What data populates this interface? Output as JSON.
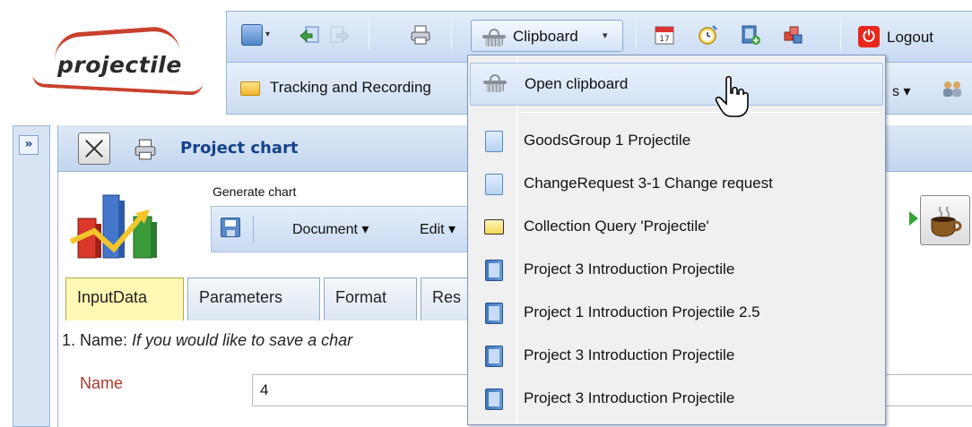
{
  "logo": {
    "text": "projectile"
  },
  "toolbar": {
    "clipboard_label": "Clipboard",
    "clipboard_caret": "▾",
    "logout_label": "Logout",
    "calendar_icon_text": "17"
  },
  "toolbar2": {
    "tracking_label": "Tracking and Recording",
    "s_label": "s ▾"
  },
  "left_strip": {
    "expand_glyph": "»"
  },
  "panel": {
    "title": "Project chart",
    "generate_label": "Generate chart",
    "document_menu": "Document ▾",
    "edit_menu": "Edit ▾"
  },
  "tabs": [
    {
      "label": "InputData"
    },
    {
      "label": "Parameters"
    },
    {
      "label": "Format"
    },
    {
      "label": "Res"
    }
  ],
  "form": {
    "name_prefix": "1. Name: ",
    "name_hint": "If you would like to save a char",
    "name_label": "Name",
    "name_value": "4"
  },
  "clipboard_menu": {
    "open_label": "Open clipboard",
    "items": [
      {
        "label": "GoodsGroup 1 Projectile",
        "icon": "document-light-icon"
      },
      {
        "label": "ChangeRequest 3-1 Change request",
        "icon": "document-light-icon"
      },
      {
        "label": "Collection Query 'Projectile'",
        "icon": "folder-icon"
      },
      {
        "label": "Project 3 Introduction Projectile",
        "icon": "document-dark-icon"
      },
      {
        "label": "Project 1 Introduction Projectile 2.5",
        "icon": "document-dark-icon"
      },
      {
        "label": "Project 3 Introduction Projectile",
        "icon": "document-dark-icon"
      },
      {
        "label": "Project 3 Introduction Projectile",
        "icon": "document-dark-icon"
      }
    ]
  },
  "colors": {
    "accent": "#15428b",
    "logo_red": "#c9412d",
    "logout_red": "#e8281c",
    "active_tab": "#fff8b4"
  }
}
